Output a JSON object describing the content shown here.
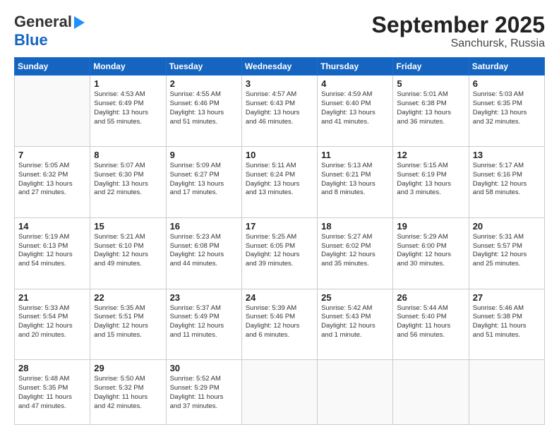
{
  "logo": {
    "line1": "General",
    "line2": "Blue"
  },
  "title": "September 2025",
  "subtitle": "Sanchursk, Russia",
  "days_header": [
    "Sunday",
    "Monday",
    "Tuesday",
    "Wednesday",
    "Thursday",
    "Friday",
    "Saturday"
  ],
  "weeks": [
    [
      {
        "day": "",
        "info": ""
      },
      {
        "day": "1",
        "info": "Sunrise: 4:53 AM\nSunset: 6:49 PM\nDaylight: 13 hours\nand 55 minutes."
      },
      {
        "day": "2",
        "info": "Sunrise: 4:55 AM\nSunset: 6:46 PM\nDaylight: 13 hours\nand 51 minutes."
      },
      {
        "day": "3",
        "info": "Sunrise: 4:57 AM\nSunset: 6:43 PM\nDaylight: 13 hours\nand 46 minutes."
      },
      {
        "day": "4",
        "info": "Sunrise: 4:59 AM\nSunset: 6:40 PM\nDaylight: 13 hours\nand 41 minutes."
      },
      {
        "day": "5",
        "info": "Sunrise: 5:01 AM\nSunset: 6:38 PM\nDaylight: 13 hours\nand 36 minutes."
      },
      {
        "day": "6",
        "info": "Sunrise: 5:03 AM\nSunset: 6:35 PM\nDaylight: 13 hours\nand 32 minutes."
      }
    ],
    [
      {
        "day": "7",
        "info": "Sunrise: 5:05 AM\nSunset: 6:32 PM\nDaylight: 13 hours\nand 27 minutes."
      },
      {
        "day": "8",
        "info": "Sunrise: 5:07 AM\nSunset: 6:30 PM\nDaylight: 13 hours\nand 22 minutes."
      },
      {
        "day": "9",
        "info": "Sunrise: 5:09 AM\nSunset: 6:27 PM\nDaylight: 13 hours\nand 17 minutes."
      },
      {
        "day": "10",
        "info": "Sunrise: 5:11 AM\nSunset: 6:24 PM\nDaylight: 13 hours\nand 13 minutes."
      },
      {
        "day": "11",
        "info": "Sunrise: 5:13 AM\nSunset: 6:21 PM\nDaylight: 13 hours\nand 8 minutes."
      },
      {
        "day": "12",
        "info": "Sunrise: 5:15 AM\nSunset: 6:19 PM\nDaylight: 13 hours\nand 3 minutes."
      },
      {
        "day": "13",
        "info": "Sunrise: 5:17 AM\nSunset: 6:16 PM\nDaylight: 12 hours\nand 58 minutes."
      }
    ],
    [
      {
        "day": "14",
        "info": "Sunrise: 5:19 AM\nSunset: 6:13 PM\nDaylight: 12 hours\nand 54 minutes."
      },
      {
        "day": "15",
        "info": "Sunrise: 5:21 AM\nSunset: 6:10 PM\nDaylight: 12 hours\nand 49 minutes."
      },
      {
        "day": "16",
        "info": "Sunrise: 5:23 AM\nSunset: 6:08 PM\nDaylight: 12 hours\nand 44 minutes."
      },
      {
        "day": "17",
        "info": "Sunrise: 5:25 AM\nSunset: 6:05 PM\nDaylight: 12 hours\nand 39 minutes."
      },
      {
        "day": "18",
        "info": "Sunrise: 5:27 AM\nSunset: 6:02 PM\nDaylight: 12 hours\nand 35 minutes."
      },
      {
        "day": "19",
        "info": "Sunrise: 5:29 AM\nSunset: 6:00 PM\nDaylight: 12 hours\nand 30 minutes."
      },
      {
        "day": "20",
        "info": "Sunrise: 5:31 AM\nSunset: 5:57 PM\nDaylight: 12 hours\nand 25 minutes."
      }
    ],
    [
      {
        "day": "21",
        "info": "Sunrise: 5:33 AM\nSunset: 5:54 PM\nDaylight: 12 hours\nand 20 minutes."
      },
      {
        "day": "22",
        "info": "Sunrise: 5:35 AM\nSunset: 5:51 PM\nDaylight: 12 hours\nand 15 minutes."
      },
      {
        "day": "23",
        "info": "Sunrise: 5:37 AM\nSunset: 5:49 PM\nDaylight: 12 hours\nand 11 minutes."
      },
      {
        "day": "24",
        "info": "Sunrise: 5:39 AM\nSunset: 5:46 PM\nDaylight: 12 hours\nand 6 minutes."
      },
      {
        "day": "25",
        "info": "Sunrise: 5:42 AM\nSunset: 5:43 PM\nDaylight: 12 hours\nand 1 minute."
      },
      {
        "day": "26",
        "info": "Sunrise: 5:44 AM\nSunset: 5:40 PM\nDaylight: 11 hours\nand 56 minutes."
      },
      {
        "day": "27",
        "info": "Sunrise: 5:46 AM\nSunset: 5:38 PM\nDaylight: 11 hours\nand 51 minutes."
      }
    ],
    [
      {
        "day": "28",
        "info": "Sunrise: 5:48 AM\nSunset: 5:35 PM\nDaylight: 11 hours\nand 47 minutes."
      },
      {
        "day": "29",
        "info": "Sunrise: 5:50 AM\nSunset: 5:32 PM\nDaylight: 11 hours\nand 42 minutes."
      },
      {
        "day": "30",
        "info": "Sunrise: 5:52 AM\nSunset: 5:29 PM\nDaylight: 11 hours\nand 37 minutes."
      },
      {
        "day": "",
        "info": ""
      },
      {
        "day": "",
        "info": ""
      },
      {
        "day": "",
        "info": ""
      },
      {
        "day": "",
        "info": ""
      }
    ]
  ]
}
